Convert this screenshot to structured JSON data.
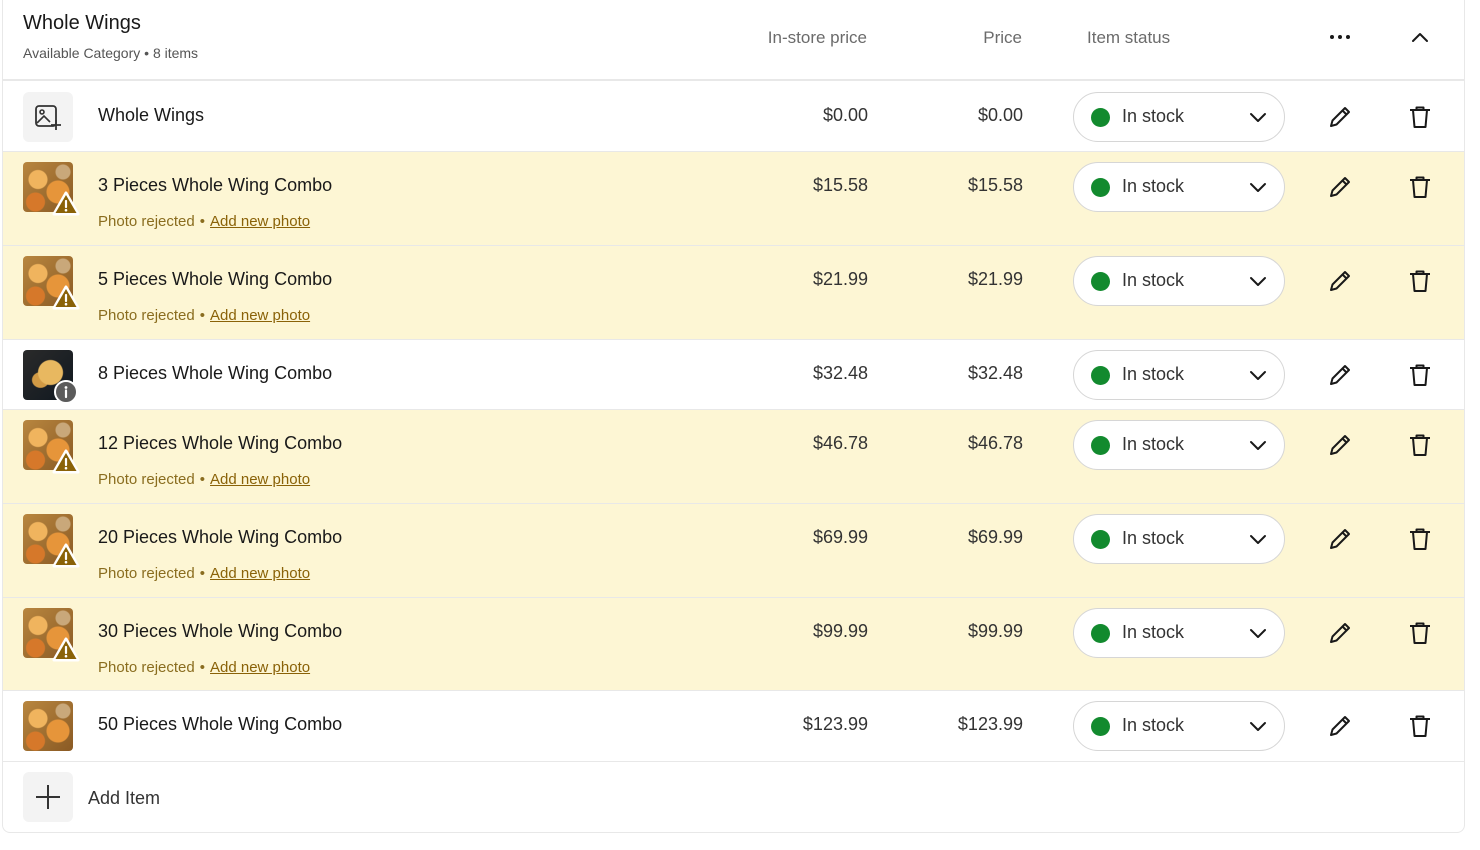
{
  "category": {
    "title": "Whole Wings",
    "subtitle": "Available Category • 8 items"
  },
  "columns": {
    "instore_price": "In-store price",
    "price": "Price",
    "item_status": "Item status"
  },
  "rejected_label": "Photo rejected",
  "separator": "•",
  "add_photo_label": "Add new photo",
  "add_item_label": "Add Item",
  "colors": {
    "rejected_row_bg": "#fdf6d4",
    "in_stock_dot": "#128a2e",
    "warning_badge": "#8a6208"
  },
  "items": [
    {
      "name": "Whole Wings",
      "instore_price": "$0.00",
      "price": "$0.00",
      "status": "In stock",
      "thumb": "image-add-icon"
    },
    {
      "name": "3 Pieces Whole Wing Combo",
      "instore_price": "$15.58",
      "price": "$15.58",
      "status": "In stock",
      "thumb": "wings-photo",
      "badge": "warning-icon"
    },
    {
      "name": "5 Pieces Whole Wing Combo",
      "instore_price": "$21.99",
      "price": "$21.99",
      "status": "In stock",
      "thumb": "wings-photo",
      "badge": "warning-icon"
    },
    {
      "name": "8 Pieces Whole Wing Combo",
      "instore_price": "$32.48",
      "price": "$32.48",
      "status": "In stock",
      "thumb": "wings-fries-photo",
      "badge": "info-icon"
    },
    {
      "name": "12 Pieces Whole Wing Combo",
      "instore_price": "$46.78",
      "price": "$46.78",
      "status": "In stock",
      "thumb": "wings-photo",
      "badge": "warning-icon"
    },
    {
      "name": "20 Pieces Whole Wing Combo",
      "instore_price": "$69.99",
      "price": "$69.99",
      "status": "In stock",
      "thumb": "wings-photo",
      "badge": "warning-icon"
    },
    {
      "name": "30 Pieces Whole Wing Combo",
      "instore_price": "$99.99",
      "price": "$99.99",
      "status": "In stock",
      "thumb": "wings-photo",
      "badge": "warning-icon"
    },
    {
      "name": "50 Pieces Whole Wing Combo",
      "instore_price": "$123.99",
      "price": "$123.99",
      "status": "In stock",
      "thumb": "wings-photo"
    }
  ]
}
